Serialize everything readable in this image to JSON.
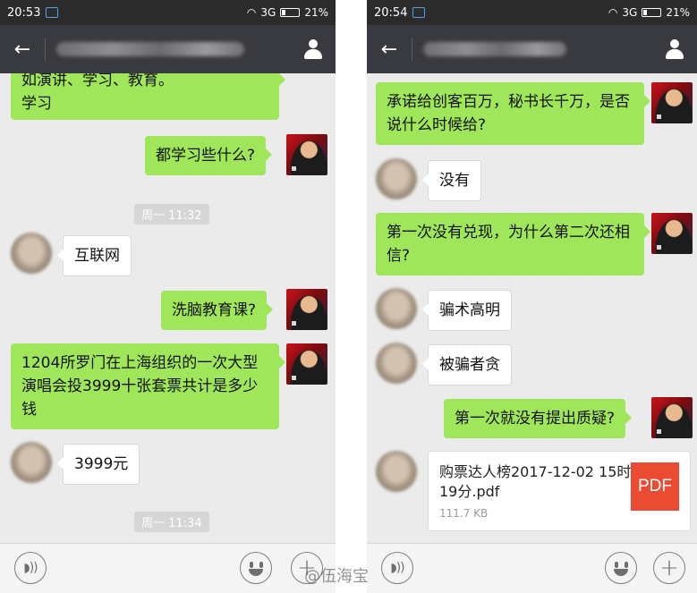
{
  "left": {
    "status": {
      "time": "20:53",
      "network": "3G",
      "battery": "21%"
    },
    "messages": {
      "m1": "如演讲、学习、教育。\n学习",
      "m2": "都学习些什么?",
      "ts1": "周一 11:32",
      "m3": "互联网",
      "m4": "洗脑教育课?",
      "m5": "1204所罗门在上海组织的一次大型演唱会投3999十张套票共计是多少钱",
      "m6": "3999元",
      "ts2": "周一 11:34"
    }
  },
  "right": {
    "status": {
      "time": "20:54",
      "network": "3G",
      "battery": "21%"
    },
    "messages": {
      "m1": "承诺给创客百万，秘书长千万，是否说什么时候给?",
      "m2": "没有",
      "m3": "第一次没有兑现，为什么第二次还相信?",
      "m4": "骗术高明",
      "m5": "被骗者贪",
      "m6": "第一次就没有提出质疑?"
    },
    "file": {
      "name": "购票达人榜2017-12-02 15时19分.pdf",
      "size": "111.7 KB",
      "icon_label": "PDF"
    }
  },
  "watermark": "@伍海宝",
  "icons": [
    "back-arrow-icon",
    "person-icon",
    "voice-icon",
    "emoji-icon",
    "plus-icon",
    "pdf-icon",
    "wifi-icon",
    "signal-icon",
    "battery-icon"
  ],
  "colors": {
    "outgoing_bubble": "#9fe65a",
    "title_bar": "#393a3f",
    "chat_bg": "#ebebeb",
    "pdf_red": "#ec4b33"
  }
}
